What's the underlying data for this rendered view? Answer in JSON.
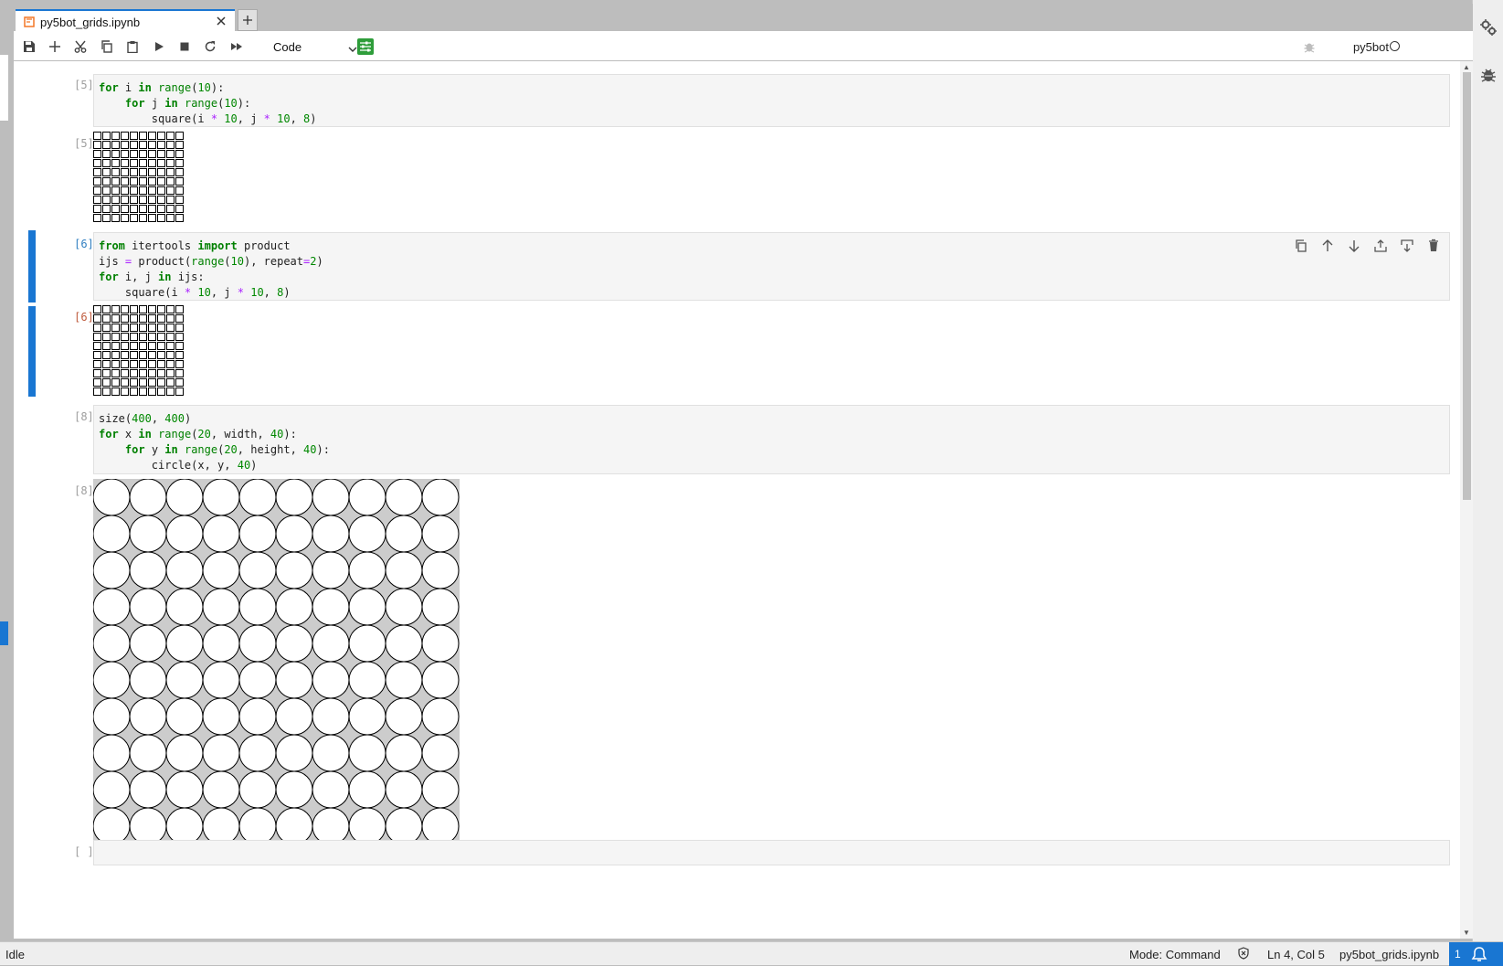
{
  "tab": {
    "title": "py5bot_grids.ipynb",
    "new_tab": "+"
  },
  "toolbar": {
    "cell_type": "Code",
    "kernel": "py5bot"
  },
  "cells": [
    {
      "in_prompt": "[5]:",
      "out_prompt": "[5]:",
      "code": [
        [
          [
            "kw",
            "for"
          ],
          [
            "",
            " i "
          ],
          [
            "kw",
            "in"
          ],
          [
            "",
            " "
          ],
          [
            "bi",
            "range"
          ],
          [
            "",
            "("
          ],
          [
            "num",
            "10"
          ],
          [
            "",
            "):"
          ]
        ],
        [
          [
            "",
            "    "
          ],
          [
            "kw",
            "for"
          ],
          [
            "",
            " j "
          ],
          [
            "kw",
            "in"
          ],
          [
            "",
            " "
          ],
          [
            "bi",
            "range"
          ],
          [
            "",
            "("
          ],
          [
            "num",
            "10"
          ],
          [
            "",
            "):"
          ]
        ],
        [
          [
            "",
            "        square(i "
          ],
          [
            "op",
            "*"
          ],
          [
            "",
            " "
          ],
          [
            "num",
            "10"
          ],
          [
            "",
            ", j "
          ],
          [
            "op",
            "*"
          ],
          [
            "",
            " "
          ],
          [
            "num",
            "10"
          ],
          [
            "",
            ", "
          ],
          [
            "num",
            "8"
          ],
          [
            "",
            ")"
          ]
        ]
      ],
      "output": {
        "kind": "squares",
        "rows": 10,
        "cols": 10
      }
    },
    {
      "in_prompt": "[6]:",
      "out_prompt": "[6]:",
      "code": [
        [
          [
            "kw",
            "from"
          ],
          [
            "",
            " itertools "
          ],
          [
            "kw",
            "import"
          ],
          [
            "",
            " product"
          ]
        ],
        [
          [
            "",
            "ijs "
          ],
          [
            "op",
            "="
          ],
          [
            "",
            " product("
          ],
          [
            "bi",
            "range"
          ],
          [
            "",
            "("
          ],
          [
            "num",
            "10"
          ],
          [
            "",
            "), repeat"
          ],
          [
            "op",
            "="
          ],
          [
            "num",
            "2"
          ],
          [
            "",
            ")"
          ]
        ],
        [
          [
            "kw",
            "for"
          ],
          [
            "",
            " i, j "
          ],
          [
            "kw",
            "in"
          ],
          [
            "",
            " ijs:"
          ]
        ],
        [
          [
            "",
            "    square(i "
          ],
          [
            "op",
            "*"
          ],
          [
            "",
            " "
          ],
          [
            "num",
            "10"
          ],
          [
            "",
            ", j "
          ],
          [
            "op",
            "*"
          ],
          [
            "",
            " "
          ],
          [
            "num",
            "10"
          ],
          [
            "",
            ", "
          ],
          [
            "num",
            "8"
          ],
          [
            "",
            ")"
          ]
        ]
      ],
      "output": {
        "kind": "squares",
        "rows": 10,
        "cols": 10
      }
    },
    {
      "in_prompt": "[8]:",
      "out_prompt": "[8]:",
      "code": [
        [
          [
            "",
            "size("
          ],
          [
            "num",
            "400"
          ],
          [
            "",
            ", "
          ],
          [
            "num",
            "400"
          ],
          [
            "",
            ")"
          ]
        ],
        [
          [
            "kw",
            "for"
          ],
          [
            "",
            " x "
          ],
          [
            "kw",
            "in"
          ],
          [
            "",
            " "
          ],
          [
            "bi",
            "range"
          ],
          [
            "",
            "("
          ],
          [
            "num",
            "20"
          ],
          [
            "",
            ", width, "
          ],
          [
            "num",
            "40"
          ],
          [
            "",
            "):"
          ]
        ],
        [
          [
            "",
            "    "
          ],
          [
            "kw",
            "for"
          ],
          [
            "",
            " y "
          ],
          [
            "kw",
            "in"
          ],
          [
            "",
            " "
          ],
          [
            "bi",
            "range"
          ],
          [
            "",
            "("
          ],
          [
            "num",
            "20"
          ],
          [
            "",
            ", height, "
          ],
          [
            "num",
            "40"
          ],
          [
            "",
            "):"
          ]
        ],
        [
          [
            "",
            "        circle(x, y, "
          ],
          [
            "num",
            "40"
          ],
          [
            "",
            ")"
          ]
        ]
      ],
      "output": {
        "kind": "circles",
        "rows": 10,
        "cols": 10
      }
    },
    {
      "in_prompt": "[ ]:",
      "code": []
    }
  ],
  "status": {
    "left": "Idle",
    "mode": "Mode: Command",
    "position": "Ln 4, Col 5",
    "file": "py5bot_grids.ipynb",
    "notifications": "1"
  },
  "colors": {
    "accent": "#1976d2",
    "canvas_bg": "#cccccc"
  }
}
